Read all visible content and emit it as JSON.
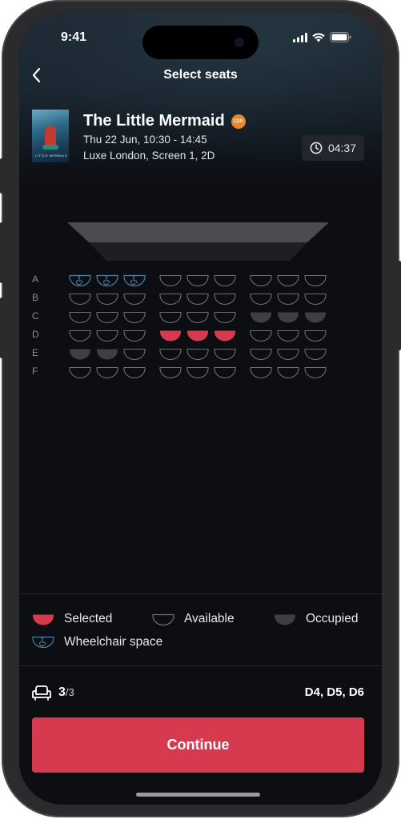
{
  "status_bar": {
    "time": "9:41"
  },
  "nav": {
    "title": "Select seats",
    "back_icon": "chevron-left-icon"
  },
  "movie": {
    "title": "The Little Mermaid",
    "rating": "12A",
    "rating_color": "#e9862b",
    "datetime": "Thu 22 Jun, 10:30 - 14:45",
    "venue": "Luxe London, Screen 1, 2D",
    "poster_text": "LITTLE MERMAID"
  },
  "timer": {
    "icon": "clock-icon",
    "value": "04:37"
  },
  "seat_map": {
    "rows": [
      "A",
      "B",
      "C",
      "D",
      "E",
      "F"
    ],
    "seats_per_section": 3,
    "sections": 3,
    "seat_states": {
      "A": [
        "wheelchair",
        "wheelchair",
        "wheelchair",
        "available",
        "available",
        "available",
        "available",
        "available",
        "available"
      ],
      "B": [
        "available",
        "available",
        "available",
        "available",
        "available",
        "available",
        "available",
        "available",
        "available"
      ],
      "C": [
        "available",
        "available",
        "available",
        "available",
        "available",
        "available",
        "occupied",
        "occupied",
        "occupied"
      ],
      "D": [
        "available",
        "available",
        "available",
        "selected",
        "selected",
        "selected",
        "available",
        "available",
        "available"
      ],
      "E": [
        "occupied",
        "occupied",
        "available",
        "available",
        "available",
        "available",
        "available",
        "available",
        "available"
      ],
      "F": [
        "available",
        "available",
        "available",
        "available",
        "available",
        "available",
        "available",
        "available",
        "available"
      ]
    }
  },
  "legend": {
    "selected": "Selected",
    "available": "Available",
    "occupied": "Occupied",
    "wheelchair": "Wheelchair space"
  },
  "colors": {
    "selected": "#d53a4f",
    "available_stroke": "#6c6f77",
    "occupied": "#3d3f45",
    "wheelchair": "#4a7fa8",
    "accent": "#d53a4f"
  },
  "footer": {
    "seat_icon": "armchair-icon",
    "count_selected": "3",
    "count_total": "/3",
    "picked_seats": "D4, D5, D6"
  },
  "cta": {
    "label": "Continue"
  }
}
